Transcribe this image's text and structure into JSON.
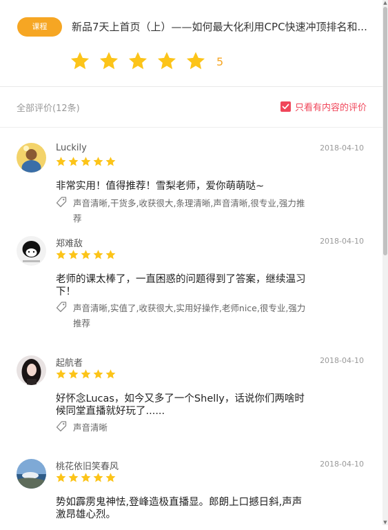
{
  "header": {
    "badge": "课程",
    "title": "新品7天上首页（上）——如何最大化利用CPC快速冲顶排名和...",
    "rating_stars": 5,
    "score": "5"
  },
  "filter": {
    "all_count": "全部评价(12条)",
    "only_content_label": "只看有内容的评价",
    "only_content_checked": true
  },
  "colors": {
    "accent": "#f6a623",
    "star": "#fcc419",
    "checkbox": "#f0465a"
  },
  "reviews": [
    {
      "username": "Luckily",
      "date": "2018-04-10",
      "stars": 5,
      "content": "非常实用！值得推荐！雪梨老师，爱你萌萌哒~",
      "tags": "声音清晰,干货多,收获很大,条理清晰,声音清晰,很专业,强力推荐",
      "avatar": "avatar-yellow"
    },
    {
      "username": "郑难敌",
      "date": "2018-04-10",
      "stars": 5,
      "content": "老师的课太棒了，一直困惑的问题得到了答案，继续温习下！",
      "tags": "声音清晰,实值了,收获很大,实用好操作,老师nice,很专业,强力推荐",
      "avatar": "avatar-meme"
    },
    {
      "username": "起航者",
      "date": "2018-04-10",
      "stars": 5,
      "content": "好怀念Lucas，如今又多了一个Shelly，话说你们两啥时候同堂直播就好玩了......",
      "tags": "声音清晰",
      "avatar": "avatar-girl"
    },
    {
      "username": "桃花依旧笑春风",
      "date": "2018-04-10",
      "stars": 5,
      "content": "势如霹雳鬼神怯,登峰造极直播显。郎朗上口撼日斜,声声激昂雄心烈。",
      "tags": "",
      "avatar": "avatar-landscape"
    }
  ]
}
